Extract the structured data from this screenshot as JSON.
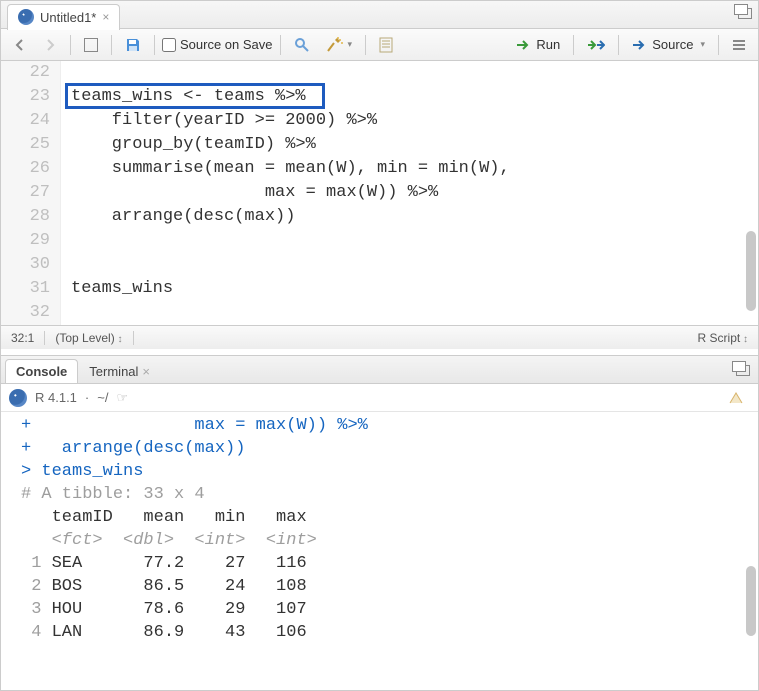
{
  "file_tab": {
    "title": "Untitled1*",
    "dirty": true
  },
  "toolbar": {
    "source_on_save_label": "Source on Save",
    "run_label": "Run",
    "source_label": "Source"
  },
  "editor": {
    "lines": [
      {
        "n": 22,
        "text": ""
      },
      {
        "n": 23,
        "text": "teams_wins <- teams %>%"
      },
      {
        "n": 24,
        "text": "    filter(yearID >= 2000) %>%"
      },
      {
        "n": 25,
        "text": "    group_by(teamID) %>%"
      },
      {
        "n": 26,
        "text": "    summarise(mean = mean(W), min = min(W),"
      },
      {
        "n": 27,
        "text": "                   max = max(W)) %>%"
      },
      {
        "n": 28,
        "text": "    arrange(desc(max))"
      },
      {
        "n": 29,
        "text": ""
      },
      {
        "n": 30,
        "text": ""
      },
      {
        "n": 31,
        "text": "teams_wins"
      },
      {
        "n": 32,
        "text": ""
      }
    ],
    "highlighted_line": 23
  },
  "status": {
    "cursor": "32:1",
    "scope": "(Top Level)",
    "mode": "R Script"
  },
  "console_tabs": {
    "console": "Console",
    "terminal": "Terminal"
  },
  "console_header": {
    "version": "R 4.1.1",
    "path": "~/"
  },
  "chart_data": {
    "type": "table",
    "title": "# A tibble: 33 x 4",
    "columns": [
      "teamID",
      "mean",
      "min",
      "max"
    ],
    "coltypes": [
      "<fct>",
      "<dbl>",
      "<int>",
      "<int>"
    ],
    "rows": [
      {
        "n": 1,
        "teamID": "SEA",
        "mean": 77.2,
        "min": 27,
        "max": 116
      },
      {
        "n": 2,
        "teamID": "BOS",
        "mean": 86.5,
        "min": 24,
        "max": 108
      },
      {
        "n": 3,
        "teamID": "HOU",
        "mean": 78.6,
        "min": 29,
        "max": 107
      },
      {
        "n": 4,
        "teamID": "LAN",
        "mean": 86.9,
        "min": 43,
        "max": 106
      }
    ]
  },
  "console_echo": {
    "cont1": "+                max = max(W)) %>%",
    "cont2": "+   arrange(desc(max))",
    "cmd": "> teams_wins"
  }
}
